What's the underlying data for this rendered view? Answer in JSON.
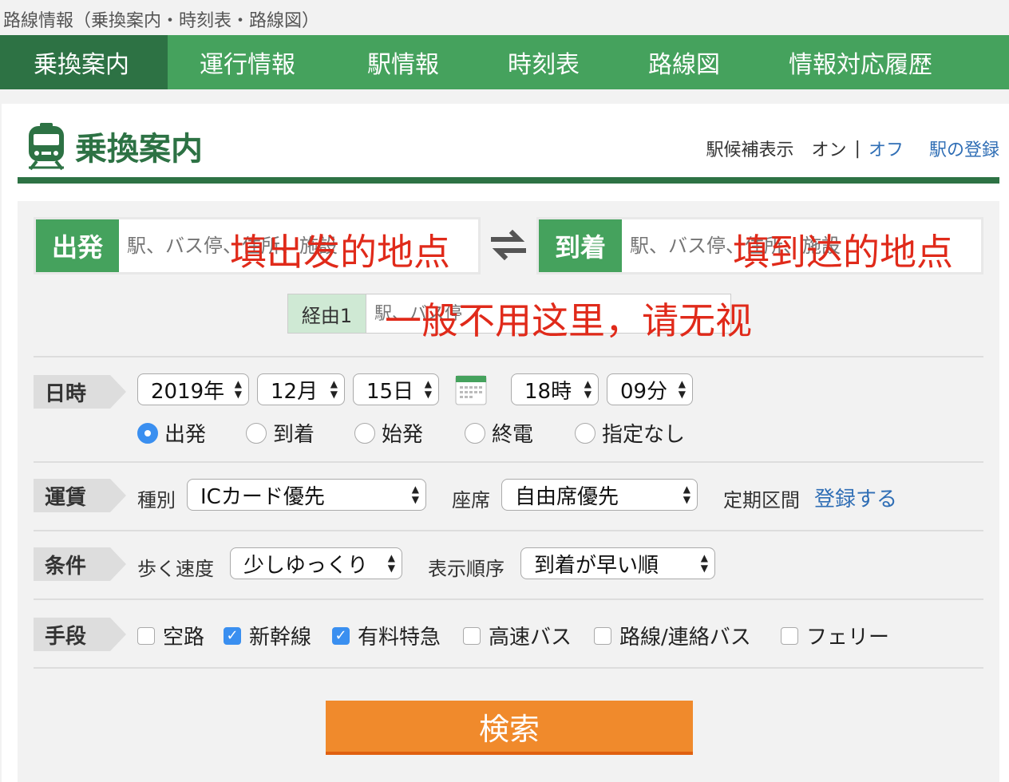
{
  "breadcrumb": "路線情報（乗換案内・時刻表・路線図）",
  "nav": [
    "乗換案内",
    "運行情報",
    "駅情報",
    "時刻表",
    "路線図",
    "情報対応履歴"
  ],
  "title": "乗換案内",
  "options": {
    "label": "駅候補表示",
    "on": "オン",
    "sep": "|",
    "off": "オフ",
    "register": "駅の登録"
  },
  "departure": {
    "label": "出発",
    "placeholder": "駅、バス停、住所、施設",
    "annotation": "填出发的地点"
  },
  "arrival": {
    "label": "到着",
    "placeholder": "駅、バス停、住所、施設",
    "annotation": "填到达的地点"
  },
  "via": {
    "label": "経由1",
    "placeholder": "駅、バス停",
    "annotation": "一般不用这里，请无视"
  },
  "datetime": {
    "label": "日時",
    "year": "2019年",
    "month": "12月",
    "day": "15日",
    "hour": "18時",
    "minute": "09分",
    "modes": [
      "出発",
      "到着",
      "始発",
      "終電",
      "指定なし"
    ],
    "selected_mode": "出発"
  },
  "fare": {
    "label": "運賃",
    "type_label": "種別",
    "type_value": "ICカード優先",
    "seat_label": "座席",
    "seat_value": "自由席優先",
    "commuter_label": "定期区間",
    "commuter_link": "登録する"
  },
  "conditions": {
    "label": "条件",
    "walk_label": "歩く速度",
    "walk_value": "少しゆっくり",
    "order_label": "表示順序",
    "order_value": "到着が早い順"
  },
  "means": {
    "label": "手段",
    "items": [
      {
        "label": "空路",
        "checked": false
      },
      {
        "label": "新幹線",
        "checked": true
      },
      {
        "label": "有料特急",
        "checked": true
      },
      {
        "label": "高速バス",
        "checked": false
      },
      {
        "label": "路線/連絡バス",
        "checked": false
      },
      {
        "label": "フェリー",
        "checked": false
      }
    ]
  },
  "search_button": "検索",
  "colors": {
    "nav_green": "#45a25d",
    "active_green": "#2d7244",
    "link_blue": "#2f6eb5",
    "search_orange": "#f08a2c",
    "annotation_red": "#e02a1a",
    "checked_blue": "#3a8ff0"
  }
}
